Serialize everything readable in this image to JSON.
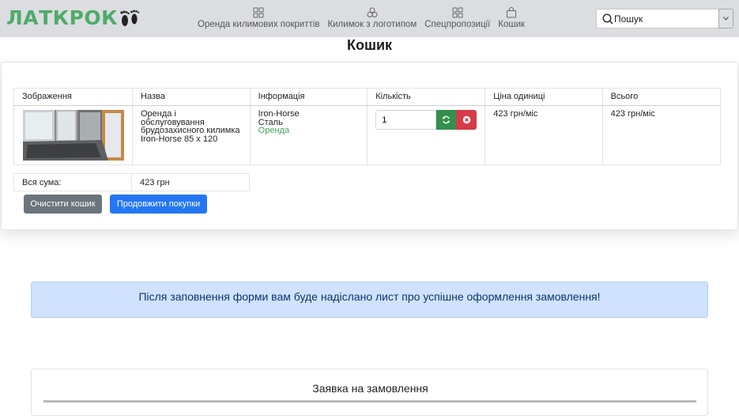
{
  "brand": {
    "name": "ЛАТКРОК",
    "color": "#4fab6b"
  },
  "nav": {
    "items": [
      {
        "label": "Оренда килимових покриттів",
        "icon": "grid-icon"
      },
      {
        "label": "Килимок з логотипом",
        "icon": "circles-icon"
      },
      {
        "label": "Спецпропозиції",
        "icon": "grid-icon"
      },
      {
        "label": "Кошик",
        "icon": "shopping-bag-icon"
      }
    ]
  },
  "search": {
    "placeholder": "Пошук"
  },
  "page": {
    "title": "Кошик"
  },
  "cart": {
    "headers": [
      "Зображення",
      "Назва",
      "Інформація",
      "Кількість",
      "Ціна одиниці",
      "Всього"
    ],
    "items": [
      {
        "name": "Оренда і обслуговування брудозахисного килимка Iron-Horse 85 x 120",
        "info": [
          "Iron-Horse",
          "Сталь",
          "Оренда"
        ],
        "quantity": "1",
        "unit_price": "423 грн/міс",
        "total": "423 грн/міс"
      }
    ],
    "total_label": "Вся сума:",
    "total_value": "423 грн",
    "clear_label": "Очистити кошик",
    "continue_label": "Продовжити покупки"
  },
  "notice": {
    "text": "Після заповнення форми вам буде надіслано лист про успішне оформлення замовлення!"
  },
  "order_form": {
    "title": "Заявка на замовлення"
  },
  "colors": {
    "accent": "#2477f3",
    "danger": "#d53c47",
    "success": "#348f4e",
    "secondary": "#6c757d"
  }
}
